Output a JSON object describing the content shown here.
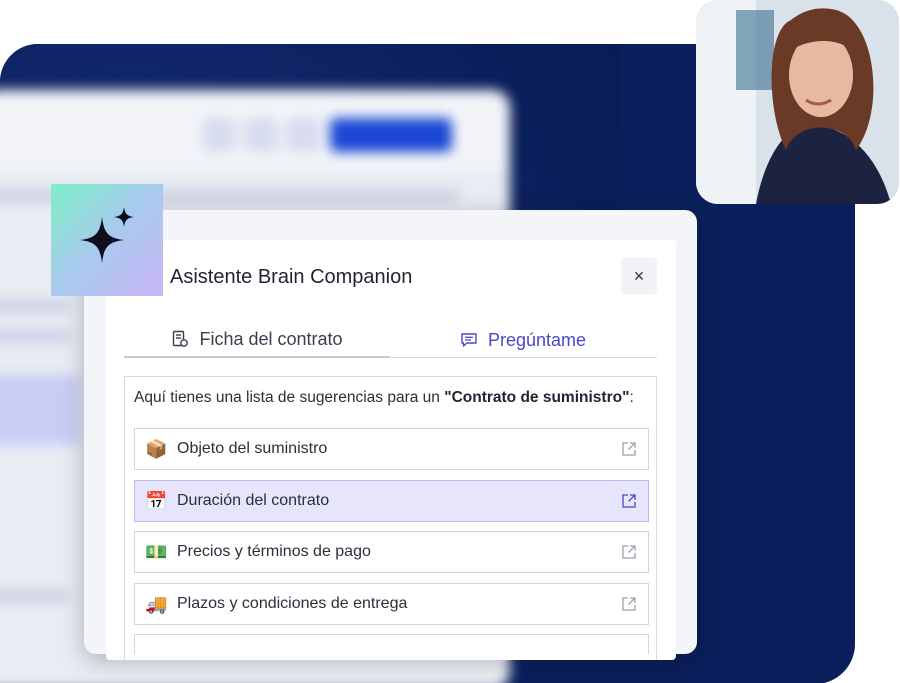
{
  "panel": {
    "title": "Asistente Brain Companion",
    "close_label": "×",
    "tabs": [
      {
        "label": "Ficha del contrato",
        "icon": "document-icon"
      },
      {
        "label": "Pregúntame",
        "icon": "chat-icon"
      }
    ],
    "intro_prefix": "Aquí tienes una lista de sugerencias para un ",
    "intro_bold": "\"Contrato de suministro\"",
    "intro_suffix": ":",
    "items": [
      {
        "emoji": "📦",
        "label": "Objeto del suministro",
        "active": false
      },
      {
        "emoji": "📅",
        "label": "Duración del contrato",
        "active": true
      },
      {
        "emoji": "💵",
        "label": "Precios y términos de pago",
        "active": false
      },
      {
        "emoji": "🚚",
        "label": "Plazos y condiciones de entrega",
        "active": false
      }
    ]
  },
  "colors": {
    "backdrop": "#0b1f5c",
    "accent": "#4b47c9",
    "active_row": "#e6e5fb",
    "primary_button": "#1a47d6"
  },
  "icons": [
    "sparkle-icon",
    "close-icon",
    "external-link-icon"
  ]
}
